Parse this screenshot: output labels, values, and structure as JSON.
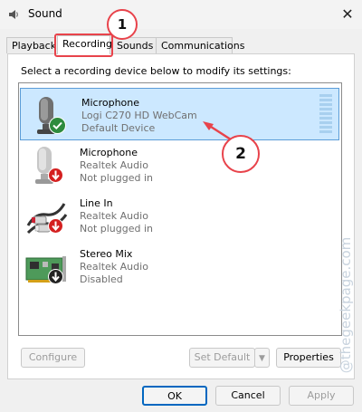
{
  "window": {
    "title": "Sound"
  },
  "tabs": [
    {
      "label": "Playback"
    },
    {
      "label": "Recording"
    },
    {
      "label": "Sounds"
    },
    {
      "label": "Communications"
    }
  ],
  "instruction": "Select a recording device below to modify its settings:",
  "devices": [
    {
      "name": "Microphone",
      "desc": "Logi C270 HD WebCam",
      "status": "Default Device",
      "badge": "check-icon",
      "selected": true
    },
    {
      "name": "Microphone",
      "desc": "Realtek Audio",
      "status": "Not plugged in",
      "badge": "down-arrow-icon",
      "selected": false
    },
    {
      "name": "Line In",
      "desc": "Realtek Audio",
      "status": "Not plugged in",
      "badge": "down-arrow-icon",
      "selected": false
    },
    {
      "name": "Stereo Mix",
      "desc": "Realtek Audio",
      "status": "Disabled",
      "badge": "down-arrow-icon",
      "selected": false
    }
  ],
  "buttons": {
    "configure": "Configure",
    "set_default": "Set Default",
    "properties": "Properties",
    "ok": "OK",
    "cancel": "Cancel",
    "apply": "Apply"
  },
  "annotations": [
    {
      "label": "1"
    },
    {
      "label": "2"
    }
  ],
  "watermark": "@thegeekpage.com",
  "colors": {
    "accent": "#0067c0",
    "selection": "#cce8ff",
    "annotation": "#e8434b"
  }
}
